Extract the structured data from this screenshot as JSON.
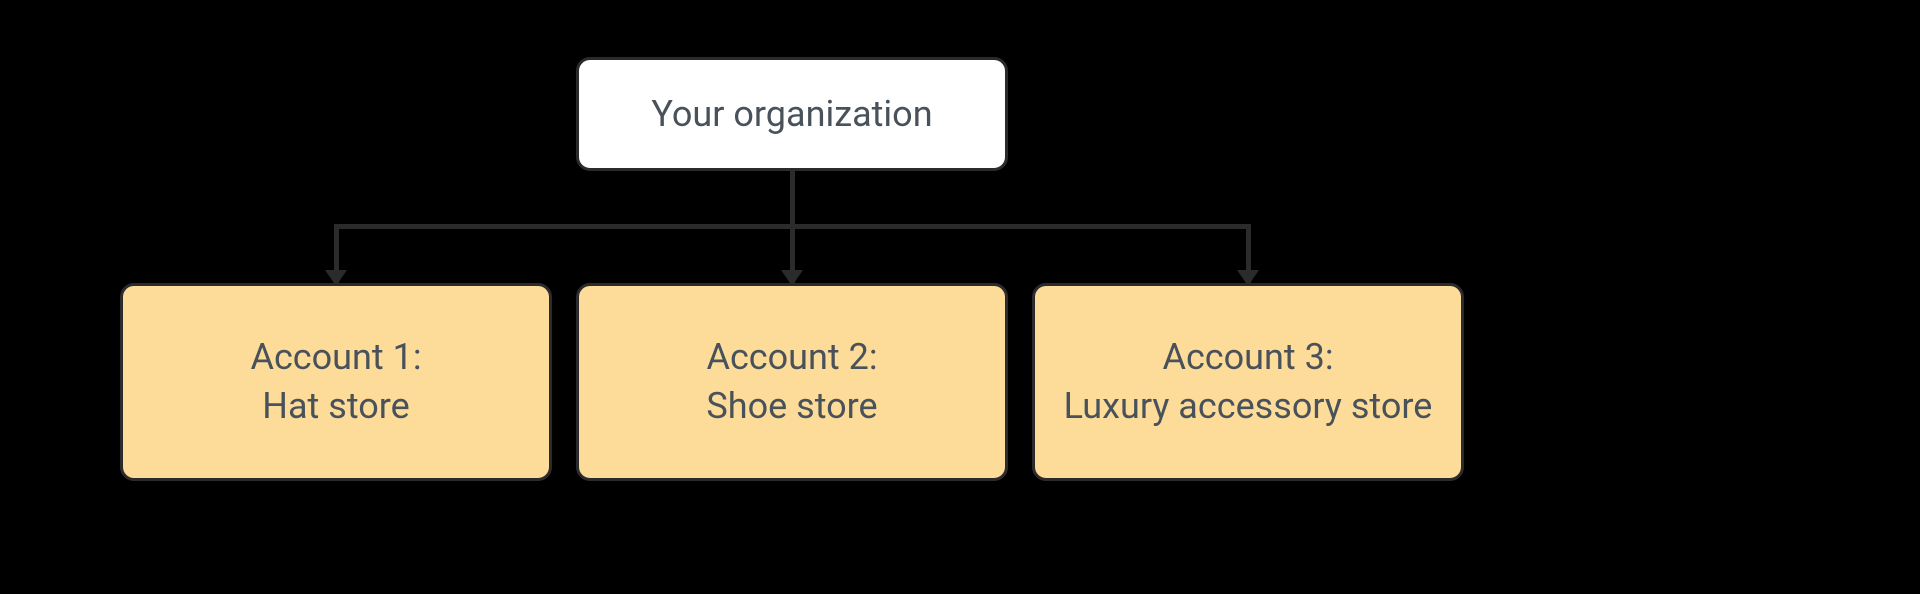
{
  "root": {
    "label": "Your organization"
  },
  "children": [
    {
      "title": "Account 1:",
      "subtitle": "Hat store"
    },
    {
      "title": "Account 2:",
      "subtitle": "Shoe store"
    },
    {
      "title": "Account 3:",
      "subtitle": "Luxury accessory store"
    }
  ],
  "colors": {
    "root_bg": "#ffffff",
    "child_bg": "#fddc9a",
    "border": "#2b2b2b",
    "text": "#49525a"
  }
}
